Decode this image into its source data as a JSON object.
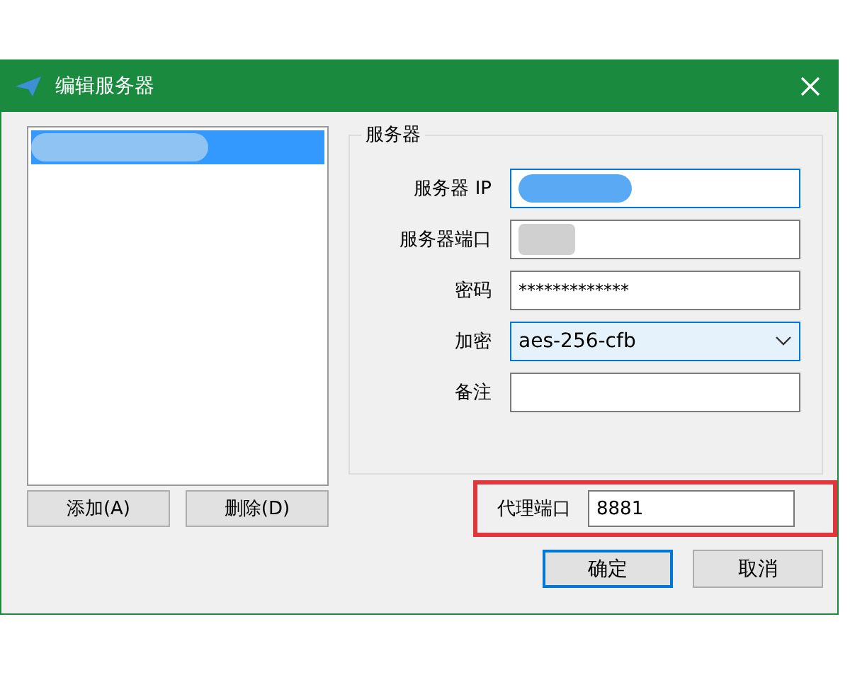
{
  "window": {
    "title": "编辑服务器"
  },
  "server_list": {
    "items": [
      {
        "selected": true,
        "redacted": true
      }
    ]
  },
  "server_group": {
    "title": "服务器",
    "fields": [
      {
        "kind": "text",
        "label": "服务器 IP",
        "redacted": true,
        "focused": true
      },
      {
        "kind": "text",
        "label": "服务器端口",
        "redacted": true,
        "focused": false
      },
      {
        "kind": "text",
        "label": "密码",
        "value": "*************",
        "focused": false
      },
      {
        "kind": "select",
        "label": "加密",
        "value": "aes-256-cfb",
        "focused": true
      },
      {
        "kind": "text",
        "label": "备注",
        "focused": false
      }
    ]
  },
  "list_buttons": [
    "添加(A)",
    "删除(D)"
  ],
  "proxy_port": {
    "label": "代理端口",
    "value": "8881",
    "highlighted": true
  },
  "buttons": [
    {
      "label": "确定",
      "default": true
    },
    {
      "label": "取消",
      "default": false
    }
  ]
}
